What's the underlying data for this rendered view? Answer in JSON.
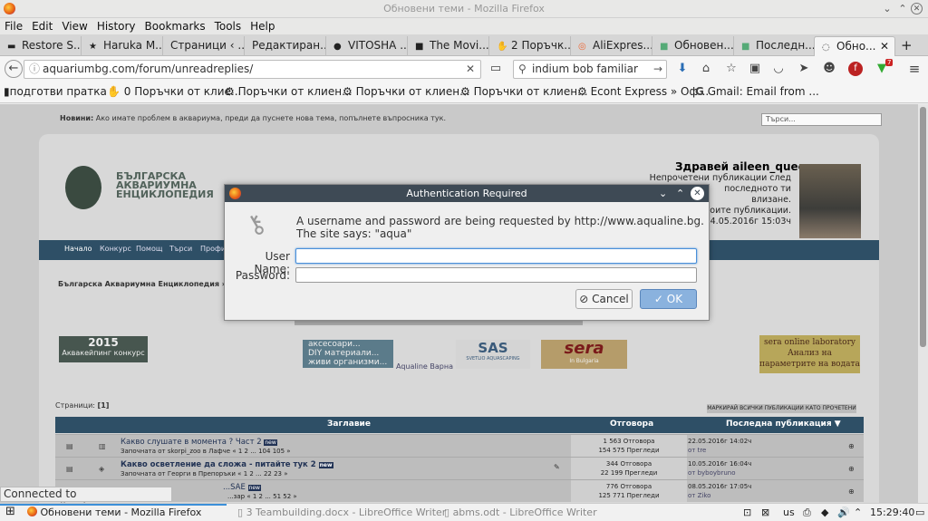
{
  "window": {
    "title": "Обновени теми - Mozilla Firefox"
  },
  "menu": [
    "File",
    "Edit",
    "View",
    "History",
    "Bookmarks",
    "Tools",
    "Help"
  ],
  "tabs": [
    {
      "label": "Restore S..."
    },
    {
      "label": "Haruka M..."
    },
    {
      "label": "Страници ‹ ..."
    },
    {
      "label": "Редактиран..."
    },
    {
      "label": "VITOSHA ..."
    },
    {
      "label": "The Movi..."
    },
    {
      "label": "2 Поръчк..."
    },
    {
      "label": "AliExpres..."
    },
    {
      "label": "Обновен..."
    },
    {
      "label": "Последн..."
    },
    {
      "label": "Обно..."
    }
  ],
  "nav": {
    "url": "aquariumbg.com/forum/unreadreplies/",
    "search": "indium bob familiar",
    "badge_count": "7"
  },
  "bookmarks": [
    "подготви пратка",
    "0 Поръчки от клие...",
    "Поръчки от клиен...",
    "Поръчки от клиен...",
    "Поръчки от клиен...",
    "Econt Express » Оф...",
    "Gmail: Email from ..."
  ],
  "site": {
    "news_label": "Новини:",
    "news_text": "Ако имате проблем в аквариума, преди да пуснете нова тема, попълнете въпросника тук.",
    "search_placeholder": "Търси...",
    "logo_text": "БЪЛГАРСКА АКВАРИУМНА ЕНЦИКЛОПЕДИЯ",
    "greeting": "Здравей aileen_queen",
    "unread_line1": "Непрочетени публикации след последното ти",
    "unread_line2": "влизане.",
    "unread_line3": "твоите публикации.",
    "unread_date": "24.05.2016г 15:03ч",
    "nav_items": [
      "Начало",
      "Конкурс",
      "Помощ",
      "Търси",
      "Профил"
    ],
    "breadcrumb": "Българска Аквариумна Енциклопедия » Обновени теми",
    "banners": {
      "contest_year": "2015",
      "contest_label": "Аквакейпинг конкурс",
      "diy_line1": "аксесоари...",
      "diy_line2": "DIY материали...",
      "diy_line3": "живи организми...",
      "varna": "Aqualine Варна",
      "sas": "SAS",
      "sas_sub": "SVETLIO AQUASCAPING",
      "sera": "sera",
      "sera_sub": "In Bulgaria",
      "lab_line1": "sera online laboratory",
      "lab_line2": "Анализ на",
      "lab_line3": "параметрите на водата"
    },
    "pages_label": "Страници:",
    "pages_value": "[1]",
    "mark_all": "МАРКИРАЙ ВСИЧКИ ПУБЛИКАЦИИ КАТО ПРОЧЕТЕНИ",
    "table_headers": {
      "title": "Заглавие",
      "replies": "Отговора",
      "last": "Последна публикация ▼"
    },
    "rows": [
      {
        "title": "Какво слушате в момента ? Част 2",
        "badge": "new",
        "starter": "Започната от skorpi_zoo в Лафче « 1 2 ... 104 105 »",
        "replies": "1 563 Отговора",
        "views": "154 575 Прегледи",
        "last_date": "22.05.2016г 14:02ч",
        "last_by": "от tre"
      },
      {
        "title": "Какво осветление да сложа - питайте тук 2",
        "badge": "new",
        "starter": "Започната от Георги в Препоръки « 1 2 ... 22 23 »",
        "replies": "344 Отговора",
        "views": "22 199 Прегледи",
        "last_date": "10.05.2016г 16:04ч",
        "last_by": "от byboybruno"
      },
      {
        "title": "...SAE",
        "badge": "new",
        "starter": "...зар « 1 2 ... 51 52 »",
        "replies": "776 Отговора",
        "views": "125 771 Прегледи",
        "last_date": "08.05.2016г 17:05ч",
        "last_by": "от Ziko"
      }
    ]
  },
  "dialog": {
    "title": "Authentication Required",
    "message": "A username and password are being requested by http://www.aqualine.bg. The site says: \"aqua\"",
    "username_label": "User Name:",
    "password_label": "Password:",
    "username_value": "",
    "password_value": "",
    "cancel": "Cancel",
    "ok": "OK"
  },
  "status": "Connected to www.aqualine.bg...",
  "taskbar": {
    "items": [
      "Обновени теми - Mozilla Firefox",
      "3 Teambuilding.docx - LibreOffice Writer",
      "abms.odt - LibreOffice Writer"
    ],
    "lang": "us",
    "clock": "15:29:40"
  }
}
